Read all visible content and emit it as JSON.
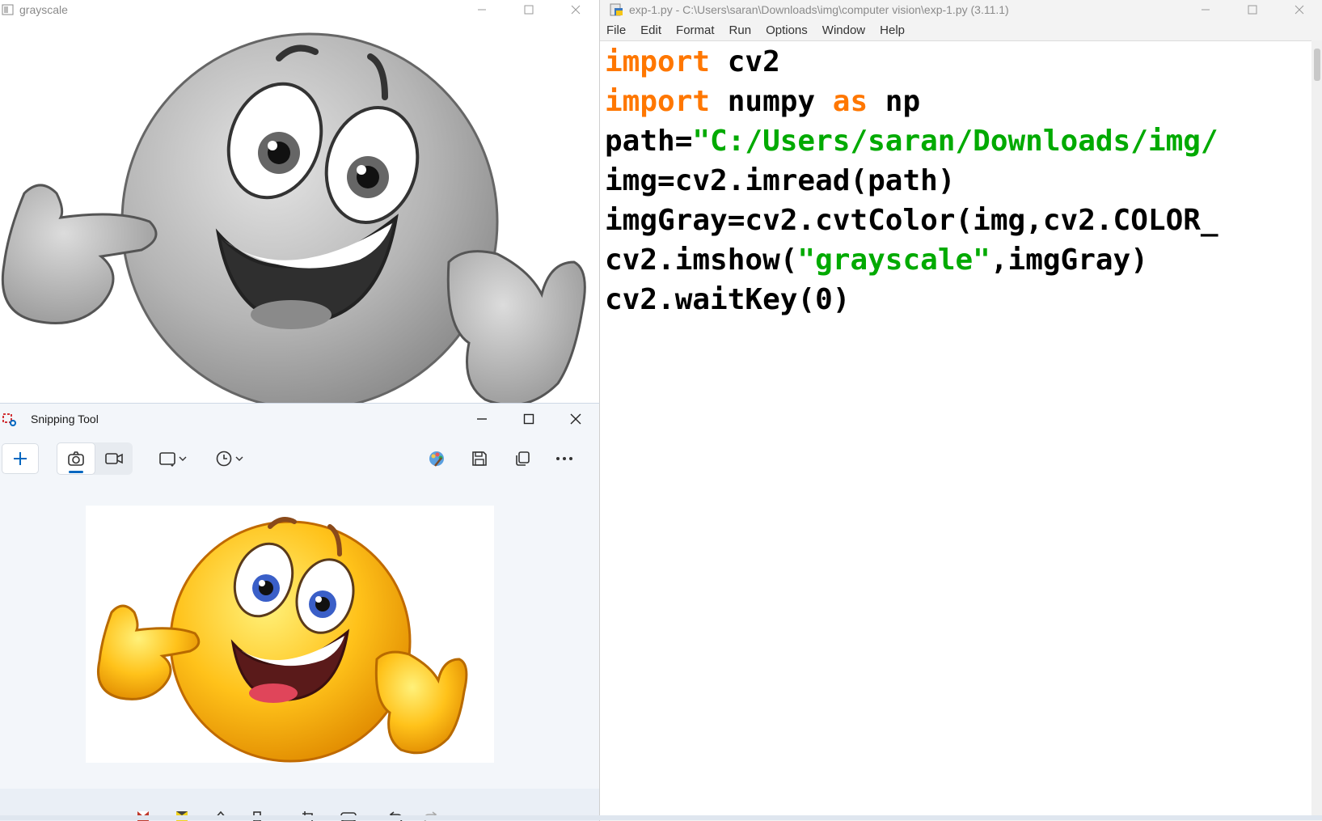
{
  "grayscale_window": {
    "title": "grayscale"
  },
  "idle_window": {
    "title": "exp-1.py - C:\\Users\\saran\\Downloads\\img\\computer vision\\exp-1.py (3.11.1)",
    "menu": [
      "File",
      "Edit",
      "Format",
      "Run",
      "Options",
      "Window",
      "Help"
    ],
    "code": {
      "line1_kw": "import",
      "line1_rest": " cv2",
      "line2_kw": "import",
      "line2_mid": " numpy ",
      "line2_kw2": "as",
      "line2_rest": " np",
      "line3_pre": "path=",
      "line3_str": "\"C:/Users/saran/Downloads/img/",
      "line4": "img=cv2.imread(path)",
      "line5": "imgGray=cv2.cvtColor(img,cv2.COLOR_",
      "line6_pre": "cv2.imshow(",
      "line6_str": "\"grayscale\"",
      "line6_post": ",imgGray)",
      "line7": "cv2.waitKey(0)"
    },
    "colors": {
      "keyword": "#ff7700",
      "string": "#00aa00"
    }
  },
  "snipping_tool": {
    "title": "Snipping Tool",
    "toolbar_icons": [
      "plus-icon",
      "camera-icon",
      "video-icon",
      "rectangle-mode-icon",
      "timer-icon",
      "paint-icon",
      "save-icon",
      "copy-icon",
      "more-icon"
    ]
  }
}
